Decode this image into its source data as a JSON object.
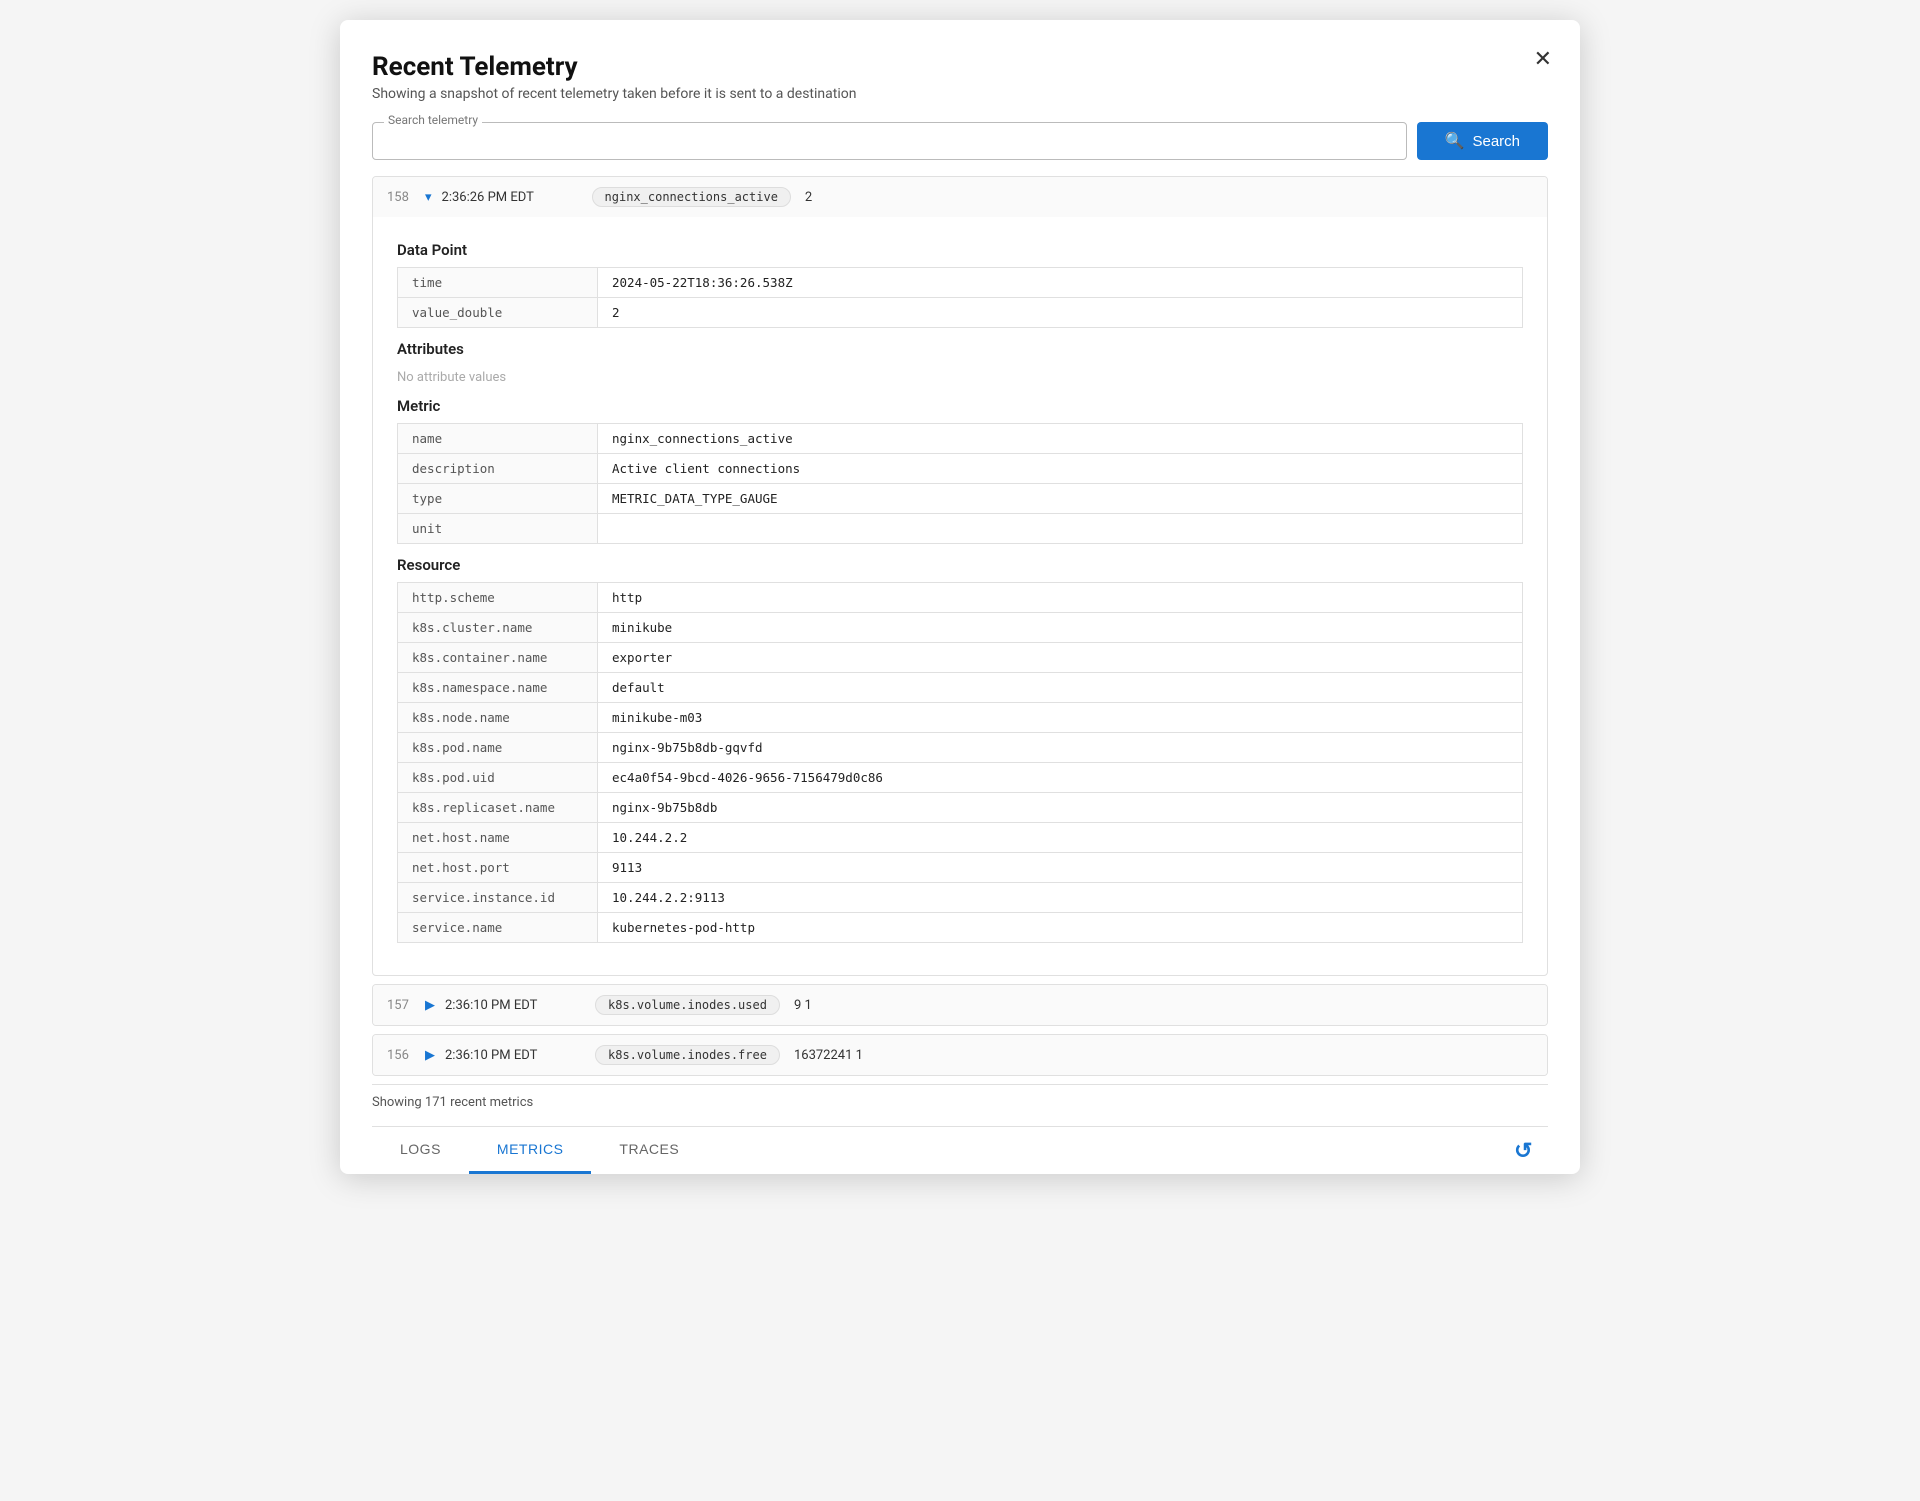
{
  "modal": {
    "title": "Recent Telemetry",
    "subtitle": "Showing a snapshot of recent telemetry taken before it is sent to a destination"
  },
  "search": {
    "label": "Search telemetry",
    "placeholder": "",
    "button_label": "Search"
  },
  "telemetry_items": [
    {
      "num": "158",
      "expanded": true,
      "chevron": "▾",
      "time": "2:36:26 PM EDT",
      "tag": "nginx_connections_active",
      "value": "2",
      "sections": {
        "data_point": {
          "title": "Data Point",
          "rows": [
            {
              "key": "time",
              "value": "2024-05-22T18:36:26.538Z"
            },
            {
              "key": "value_double",
              "value": "2"
            }
          ]
        },
        "attributes": {
          "title": "Attributes",
          "no_value": "No attribute values"
        },
        "metric": {
          "title": "Metric",
          "rows": [
            {
              "key": "name",
              "value": "nginx_connections_active"
            },
            {
              "key": "description",
              "value": "Active client connections"
            },
            {
              "key": "type",
              "value": "METRIC_DATA_TYPE_GAUGE"
            },
            {
              "key": "unit",
              "value": ""
            }
          ]
        },
        "resource": {
          "title": "Resource",
          "rows": [
            {
              "key": "http.scheme",
              "value": "http"
            },
            {
              "key": "k8s.cluster.name",
              "value": "minikube"
            },
            {
              "key": "k8s.container.name",
              "value": "exporter"
            },
            {
              "key": "k8s.namespace.name",
              "value": "default"
            },
            {
              "key": "k8s.node.name",
              "value": "minikube-m03"
            },
            {
              "key": "k8s.pod.name",
              "value": "nginx-9b75b8db-gqvfd"
            },
            {
              "key": "k8s.pod.uid",
              "value": "ec4a0f54-9bcd-4026-9656-7156479d0c86"
            },
            {
              "key": "k8s.replicaset.name",
              "value": "nginx-9b75b8db"
            },
            {
              "key": "net.host.name",
              "value": "10.244.2.2"
            },
            {
              "key": "net.host.port",
              "value": "9113"
            },
            {
              "key": "service.instance.id",
              "value": "10.244.2.2:9113"
            },
            {
              "key": "service.name",
              "value": "kubernetes-pod-http"
            }
          ]
        }
      }
    },
    {
      "num": "157",
      "expanded": false,
      "chevron": "▶",
      "time": "2:36:10 PM EDT",
      "tag": "k8s.volume.inodes.used",
      "value": "9  1"
    },
    {
      "num": "156",
      "expanded": false,
      "chevron": "▶",
      "time": "2:36:10 PM EDT",
      "tag": "k8s.volume.inodes.free",
      "value": "16372241  1"
    }
  ],
  "footer": {
    "showing_text": "Showing 171 recent metrics"
  },
  "tabs": [
    {
      "label": "LOGS",
      "active": false
    },
    {
      "label": "METRICS",
      "active": true
    },
    {
      "label": "TRACES",
      "active": false
    }
  ],
  "icons": {
    "close": "✕",
    "search": "🔍",
    "refresh": "↻",
    "expand": "▶",
    "collapse": "▾"
  }
}
